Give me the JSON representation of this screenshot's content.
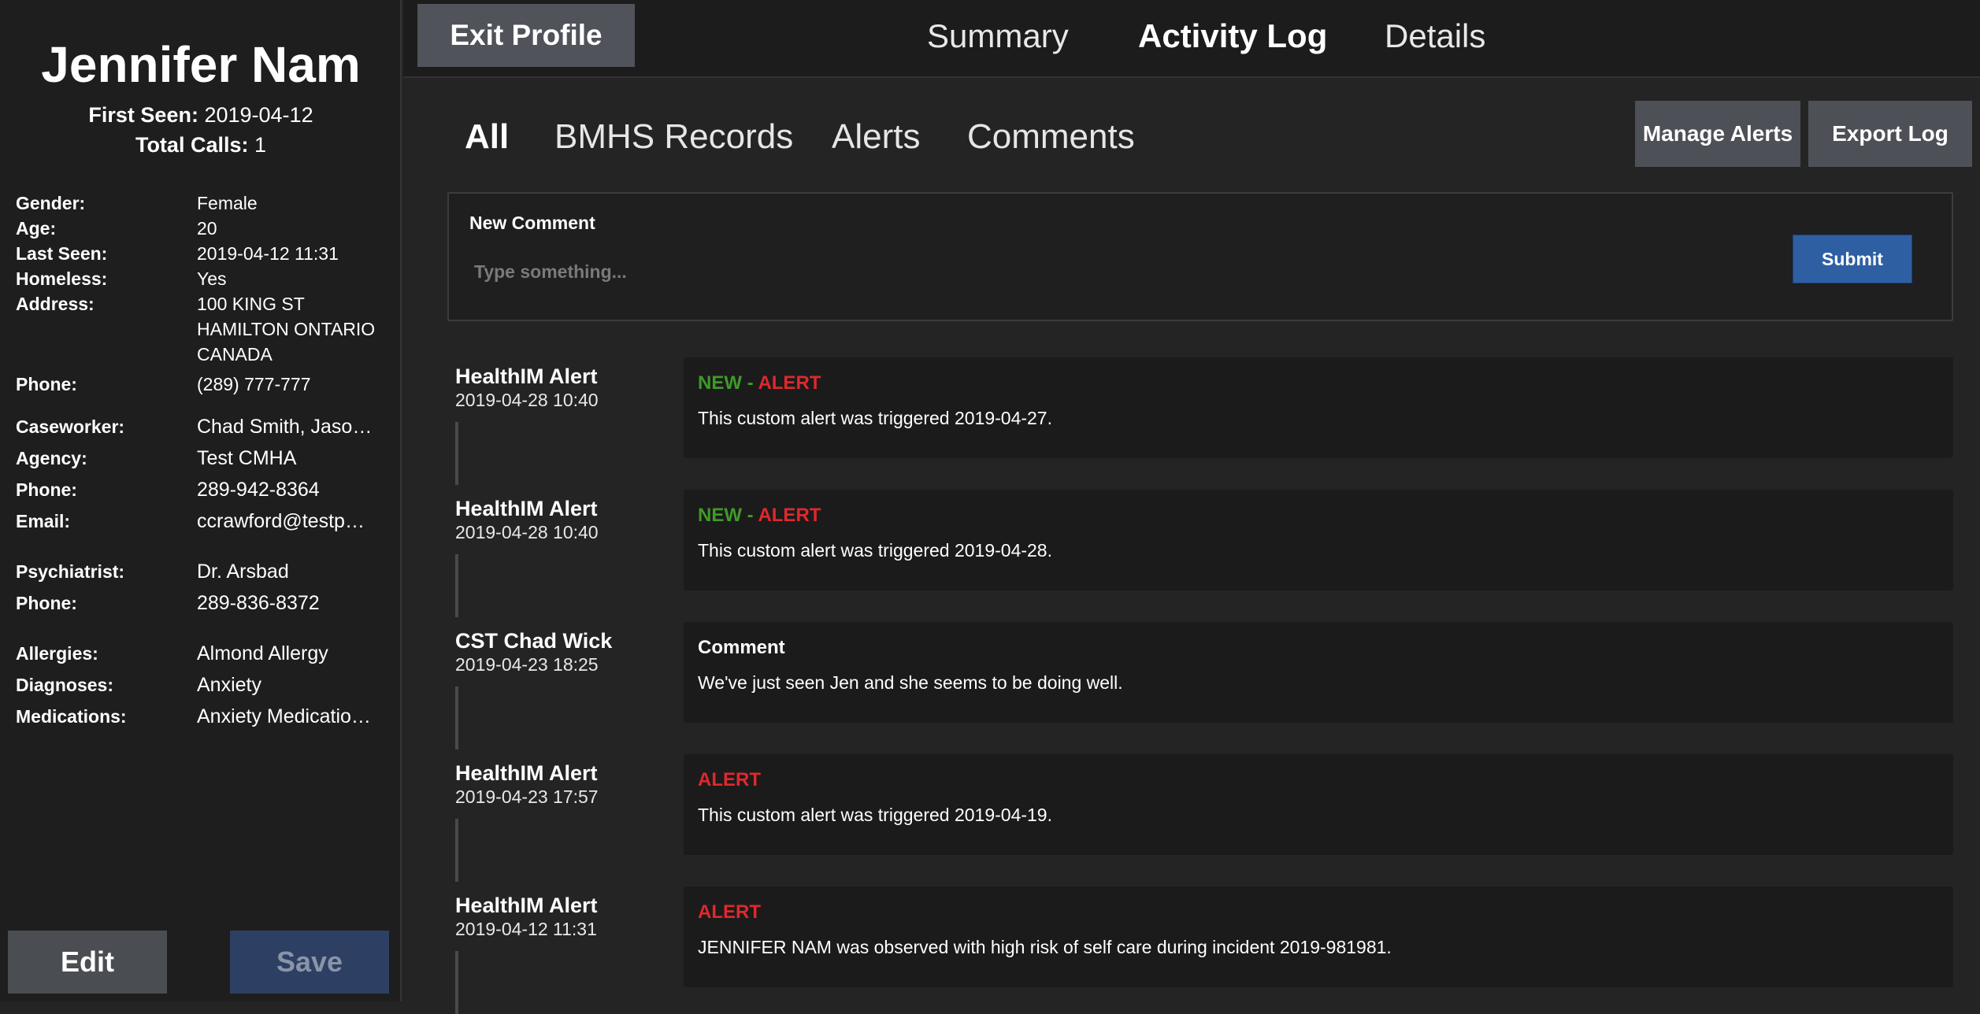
{
  "profile": {
    "name": "Jennifer Nam",
    "first_seen_label": "First Seen:",
    "first_seen": "2019-04-12",
    "total_calls_label": "Total Calls:",
    "total_calls": "1",
    "details": [
      {
        "label": "Gender:",
        "value": "Female"
      },
      {
        "label": "Age:",
        "value": "20"
      },
      {
        "label": "Last Seen:",
        "value": "2019-04-12 11:31"
      },
      {
        "label": "Homeless:",
        "value": "Yes"
      },
      {
        "label": "Address:",
        "value": "100 KING ST\nHAMILTON ONTARIO\nCANADA"
      },
      {
        "label": "Phone:",
        "value": "(289) 777-777"
      }
    ],
    "caseworker": [
      {
        "label": "Caseworker:",
        "value": "Chad Smith, Jaso…"
      },
      {
        "label": "Agency:",
        "value": "Test CMHA"
      },
      {
        "label": "Phone:",
        "value": "289-942-8364"
      },
      {
        "label": "Email:",
        "value": "ccrawford@testp…"
      }
    ],
    "psychiatrist": [
      {
        "label": "Psychiatrist:",
        "value": "Dr. Arsbad"
      },
      {
        "label": "Phone:",
        "value": "289-836-8372"
      }
    ],
    "medical": [
      {
        "label": "Allergies:",
        "value": "Almond Allergy"
      },
      {
        "label": "Diagnoses:",
        "value": "Anxiety"
      },
      {
        "label": "Medications:",
        "value": "Anxiety Medicatio…"
      }
    ],
    "edit_label": "Edit",
    "save_label": "Save"
  },
  "topbar": {
    "exit_label": "Exit Profile",
    "tabs": [
      "Summary",
      "Activity Log",
      "Details"
    ],
    "active_tab": "Activity Log"
  },
  "subtabs": {
    "items": [
      "All",
      "BMHS Records",
      "Alerts",
      "Comments"
    ],
    "active": "All",
    "manage_alerts_label": "Manage Alerts",
    "export_log_label": "Export Log"
  },
  "new_comment": {
    "label": "New Comment",
    "placeholder": "Type something...",
    "submit_label": "Submit"
  },
  "log": [
    {
      "source": "HealthIM Alert",
      "time": "2019-04-28 10:40",
      "new": "NEW",
      "sep": " - ",
      "tag": "ALERT",
      "tag_type": "alert",
      "text": "This custom alert was triggered 2019-04-27."
    },
    {
      "source": "HealthIM Alert",
      "time": "2019-04-28 10:40",
      "new": "NEW",
      "sep": " - ",
      "tag": "ALERT",
      "tag_type": "alert",
      "text": "This custom alert was triggered 2019-04-28."
    },
    {
      "source": "CST Chad Wick",
      "time": "2019-04-23 18:25",
      "new": "",
      "sep": "",
      "tag": "Comment",
      "tag_type": "plain",
      "text": "We've just seen Jen and she seems to be doing well."
    },
    {
      "source": "HealthIM Alert",
      "time": "2019-04-23 17:57",
      "new": "",
      "sep": "",
      "tag": "ALERT",
      "tag_type": "alert",
      "text": "This custom alert was triggered 2019-04-19."
    },
    {
      "source": "HealthIM Alert",
      "time": "2019-04-12 11:31",
      "new": "",
      "sep": "",
      "tag": "ALERT",
      "tag_type": "alert",
      "text": "JENNIFER NAM was observed with high risk of self care during incident 2019-981981."
    }
  ],
  "colors": {
    "new": "#3f9a2a",
    "alert": "#e0282c",
    "submit": "#2e5fa3",
    "save_disabled": "#2d3f63"
  }
}
